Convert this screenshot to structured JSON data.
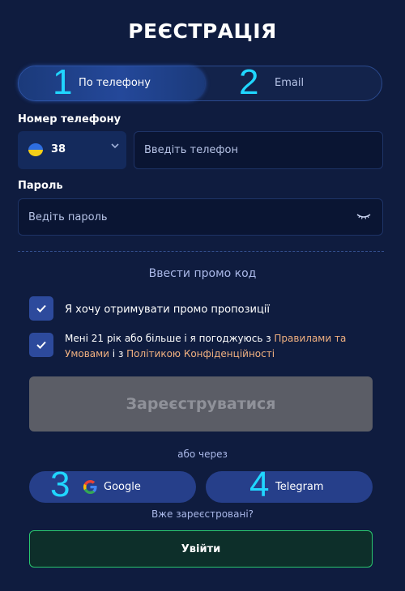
{
  "title": "РЕЄСТРАЦІЯ",
  "tabs": [
    {
      "label": "По телефону",
      "number": "1",
      "active": true
    },
    {
      "label": "Email",
      "number": "2",
      "active": false
    }
  ],
  "phone": {
    "label": "Номер телефону",
    "country_code": "38",
    "flag_icon": "ukraine-flag-icon",
    "placeholder": "Введіть телефон"
  },
  "password": {
    "label": "Пароль",
    "placeholder": "Ведіть пароль",
    "toggle_icon": "eye-closed-icon"
  },
  "promo_label": "Ввести промо код",
  "checkboxes": {
    "promo": {
      "text": "Я хочу отримувати промо пропозиції",
      "checked": true
    },
    "terms": {
      "text_before": "Мені 21 рік або більше і я погоджуюсь з ",
      "link1": "Правилами та Умовами",
      "text_mid": " і з ",
      "link2": "Політикою Конфіденційності",
      "checked": true
    }
  },
  "register_label": "Зареєструватися",
  "or_label": "або через",
  "social": [
    {
      "label": "Google",
      "number": "3",
      "icon": "google-icon"
    },
    {
      "label": "Telegram",
      "number": "4",
      "icon": "telegram-icon"
    }
  ],
  "already_label": "Вже зареєстровані?",
  "login_label": "Увійти",
  "colors": {
    "background": "#0f1c3f",
    "accent_number": "#20d6ff",
    "link": "#f0b080",
    "login_border": "#29c76f"
  }
}
